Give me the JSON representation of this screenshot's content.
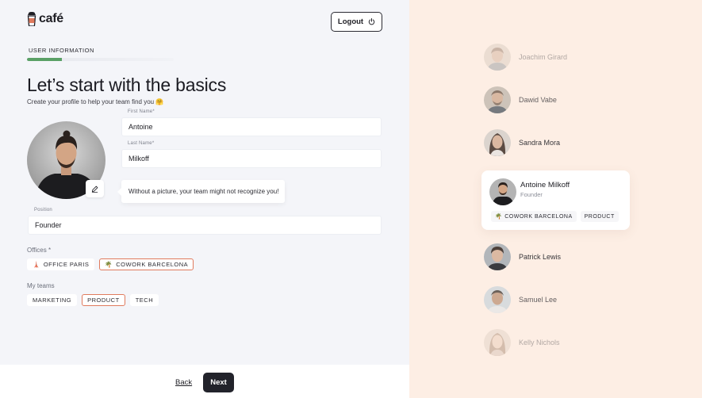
{
  "brand": {
    "name": "café"
  },
  "header": {
    "logout_label": "Logout"
  },
  "step": {
    "label": "USER INFORMATION",
    "progress": 0.24
  },
  "page": {
    "title": "Let’s start with the basics",
    "subtitle": "Create your profile to help your team find you 🤗"
  },
  "form": {
    "first_name": {
      "label": "First Name*",
      "value": "Antoine"
    },
    "last_name": {
      "label": "Last Name*",
      "value": "Milkoff"
    },
    "position": {
      "label": "Position",
      "value": "Founder"
    },
    "picture_hint": "Without a picture, your team might not recognize you!",
    "offices": {
      "label": "Offices *",
      "items": [
        {
          "label": "OFFICE PARIS",
          "emoji": "🗼",
          "selected": false
        },
        {
          "label": "COWORK BARCELONA",
          "emoji": "🌴",
          "selected": true
        }
      ]
    },
    "teams": {
      "label": "My teams",
      "items": [
        {
          "label": "MARKETING",
          "selected": false
        },
        {
          "label": "PRODUCT",
          "selected": true
        },
        {
          "label": "TECH",
          "selected": false
        }
      ]
    }
  },
  "footer": {
    "back_label": "Back",
    "next_label": "Next"
  },
  "team_panel": {
    "members": [
      {
        "name": "Joachim Girard",
        "opacity": 0.35
      },
      {
        "name": "Dawid Vabe",
        "opacity": 0.7
      },
      {
        "name": "Sandra Mora",
        "opacity": 0.9
      },
      {
        "name": "Patrick Lewis",
        "opacity": 0.9
      },
      {
        "name": "Samuel Lee",
        "opacity": 0.7
      },
      {
        "name": "Kelly Nichols",
        "opacity": 0.35
      }
    ],
    "profile_card": {
      "name": "Antoine Milkoff",
      "role": "Founder",
      "office": {
        "label": "COWORK BARCELONA",
        "emoji": "🌴"
      },
      "team": "PRODUCT"
    }
  },
  "colors": {
    "accent_green": "#5aa066",
    "selected_border": "#e07b5e",
    "right_panel_bg": "#fdeee4",
    "primary_button": "#22232b"
  }
}
